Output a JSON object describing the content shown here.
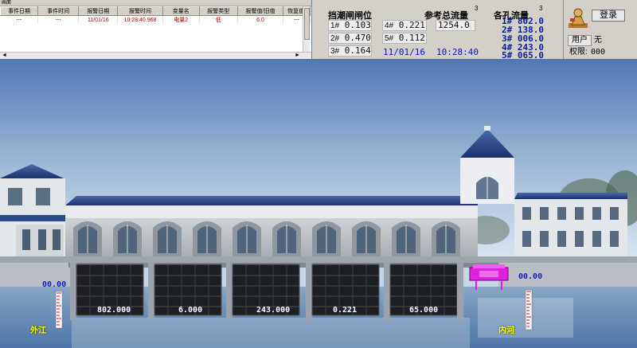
{
  "alarm_panel": {
    "title": "画面",
    "columns": [
      "事件日期",
      "事件时间",
      "报警日期",
      "报警时间",
      "变量名",
      "报警类型",
      "报警值/旧值",
      "恢复值/"
    ],
    "rows": [
      [
        "---",
        "---",
        "11/01/16",
        "10:28:40.968",
        "电量2",
        "低",
        "6.0",
        "---"
      ]
    ],
    "scroll_left": "◄",
    "scroll_right": "►"
  },
  "gate_position": {
    "title": "挡潮闸闸位",
    "gates": [
      {
        "id": "1#",
        "value": "0.103"
      },
      {
        "id": "2#",
        "value": "0.470"
      },
      {
        "id": "3#",
        "value": "0.164"
      },
      {
        "id": "4#",
        "value": "0.221"
      },
      {
        "id": "5#",
        "value": "0.112"
      }
    ]
  },
  "reference_flow": {
    "title": "参考总流量",
    "unit_glyph": "3",
    "value": "1254.0"
  },
  "datetime": {
    "date": "11/01/16",
    "time": "10:28:40"
  },
  "hole_flow": {
    "title": "各孔流量",
    "unit_glyph": "3",
    "rows": [
      {
        "id": "1#",
        "value": "802.0"
      },
      {
        "id": "2#",
        "value": "138.0"
      },
      {
        "id": "3#",
        "value": "006.0"
      },
      {
        "id": "4#",
        "value": "243.0"
      },
      {
        "id": "5#",
        "value": "065.0"
      }
    ]
  },
  "login": {
    "button": "登录",
    "user_label": "用户",
    "user_value": "无",
    "perm_label": "权限:",
    "perm_value": "000"
  },
  "scene": {
    "outer_level": "00.00",
    "inner_level": "00.00",
    "outer_label": "外江",
    "inner_label": "内河",
    "gate_flows": [
      "802.000",
      "6.000",
      "243.000",
      "0.221",
      "65.000"
    ]
  },
  "colors": {
    "sky_top": "#4f78b4",
    "sky_bottom": "#dde8f2",
    "roof": "#2f4a8a",
    "flow_blue": "#0a1e9c",
    "pump_magenta": "#e020e0",
    "label_yellow": "#ffff00"
  }
}
